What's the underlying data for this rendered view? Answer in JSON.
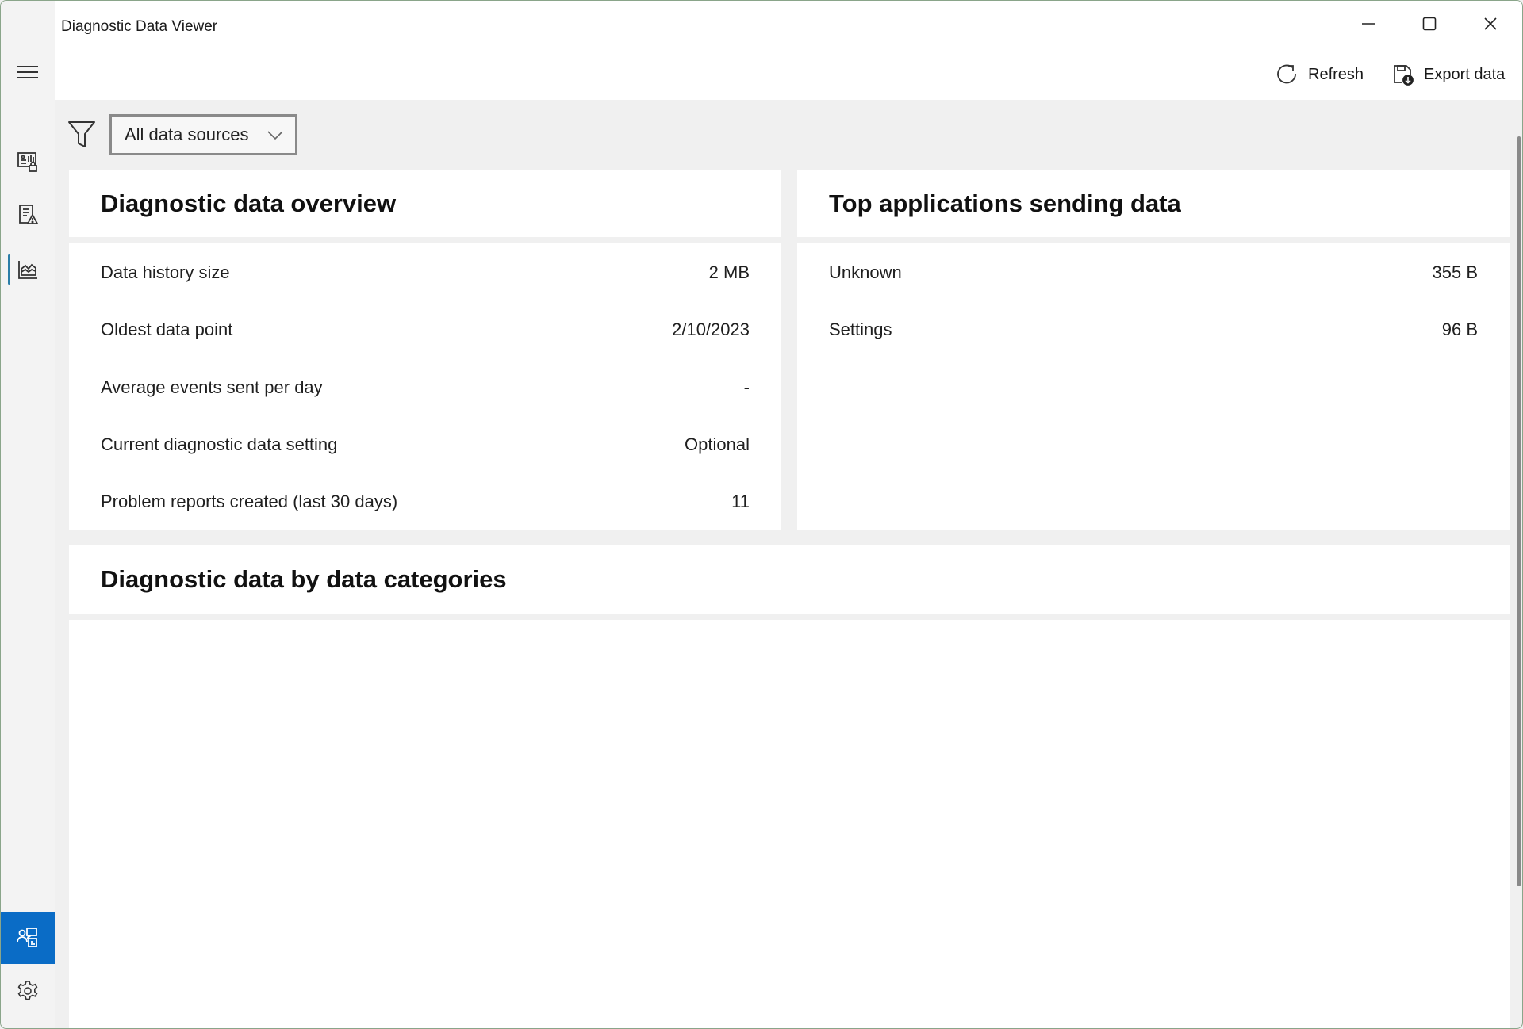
{
  "window": {
    "title": "Diagnostic Data Viewer",
    "controls": {
      "minimize": "minimize-icon",
      "maximize": "maximize-icon",
      "close": "close-icon"
    }
  },
  "toolbar": {
    "refresh_label": "Refresh",
    "export_label": "Export data"
  },
  "sidebar": {
    "menu_icon": "hamburger-menu-icon",
    "items": [
      {
        "icon": "diagnostic-data-icon",
        "active": false
      },
      {
        "icon": "problem-reports-icon",
        "active": false
      },
      {
        "icon": "data-overview-icon",
        "active": true
      }
    ],
    "bottom_items": [
      {
        "icon": "feedback-icon",
        "highlighted": true
      },
      {
        "icon": "settings-icon",
        "highlighted": false
      }
    ],
    "accent_color": "#0a6cc6",
    "indicator_color": "#2b7ea8"
  },
  "filter": {
    "icon": "filter-icon",
    "selected": "All data sources"
  },
  "overview": {
    "title": "Diagnostic data overview",
    "rows": [
      {
        "label": "Data history size",
        "value": "2 MB"
      },
      {
        "label": "Oldest data point",
        "value": "2/10/2023"
      },
      {
        "label": "Average events sent per day",
        "value": "-"
      },
      {
        "label": "Current diagnostic data setting",
        "value": "Optional"
      },
      {
        "label": "Problem reports created (last 30 days)",
        "value": "11"
      }
    ]
  },
  "top_apps": {
    "title": "Top applications sending data",
    "rows": [
      {
        "label": "Unknown",
        "value": "355 B"
      },
      {
        "label": "Settings",
        "value": "96 B"
      }
    ]
  },
  "categories": {
    "title": "Diagnostic data by data categories"
  }
}
